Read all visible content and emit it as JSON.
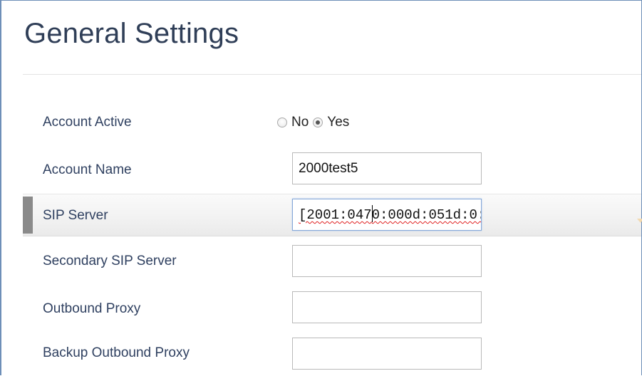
{
  "page": {
    "title": "General Settings"
  },
  "fields": {
    "account_active": {
      "label": "Account Active",
      "options": [
        "No",
        "Yes"
      ],
      "selected": "Yes"
    },
    "account_name": {
      "label": "Account Name",
      "value": "2000test5"
    },
    "sip_server": {
      "label": "SIP Server",
      "value_before_caret": "[2001:047",
      "value_after_caret": "0:000d:051d:0:"
    },
    "secondary_sip_server": {
      "label": "Secondary SIP Server",
      "value": ""
    },
    "outbound_proxy": {
      "label": "Outbound Proxy",
      "value": ""
    },
    "backup_outbound_proxy": {
      "label": "Backup Outbound Proxy",
      "value": ""
    }
  },
  "colors": {
    "title": "#2f3e57",
    "label": "#2f4060",
    "frame_border": "#6e8fb8",
    "highlight_marker": "#8a8a8a",
    "spellcheck": "#e02020"
  }
}
